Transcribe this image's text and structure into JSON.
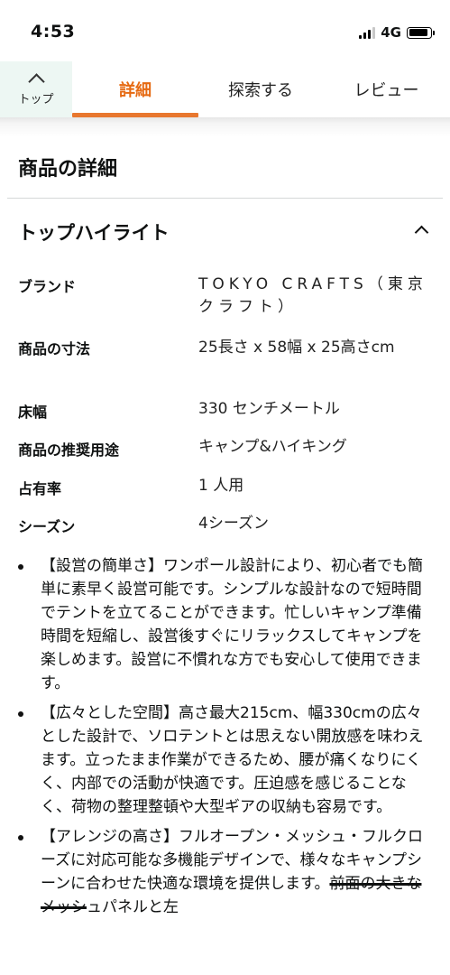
{
  "status_bar": {
    "time": "4:53",
    "network": "4G",
    "battery_level": 0.9
  },
  "tabs": {
    "top_label": "トップ",
    "details": "詳細",
    "explore": "探索する",
    "review": "レビュー",
    "active": "details",
    "accent_color": "#e8772e"
  },
  "section": {
    "title": "商品の詳細"
  },
  "highlights": {
    "title": "トップハイライト",
    "specs": [
      {
        "label": "ブランド",
        "value": "TOKYO CRAFTS（東京クラフト）"
      },
      {
        "label": "商品の寸法",
        "value": "25長さ x 58幅 x 25高さcm"
      },
      {
        "label": "床幅",
        "value": "330 センチメートル"
      },
      {
        "label": "商品の推奨用途",
        "value": "キャンプ&ハイキング"
      },
      {
        "label": "占有率",
        "value": "1 人用"
      },
      {
        "label": "シーズン",
        "value": "4シーズン"
      }
    ]
  },
  "bullets": [
    "【設営の簡単さ】ワンポール設計により、初心者でも簡単に素早く設営可能です。シンプルな設計なので短時間でテントを立てることができます。忙しいキャンプ準備時間を短縮し、設営後すぐにリラックスしてキャンプを楽しめます。設営に不慣れな方でも安心して使用できます。",
    "【広々とした空間】高さ最大215cm、幅330cmの広々とした設計で、ソロテントとは思えない開放感を味わえます。立ったまま作業ができるため、腰が痛くなりにくく、内部での活動が快適です。圧迫感を感じることなく、荷物の整理整頓や大型ギアの収納も容易です。",
    {
      "text": "【アレンジの高さ】フルオープン・メッシュ・フルクローズに対応可能な多機能デザインで、様々なキャンプシーンに合わせた快適な環境を提供します。",
      "struck": "前面の大きなメッシ",
      "rest": "ュパネルと左"
    }
  ]
}
